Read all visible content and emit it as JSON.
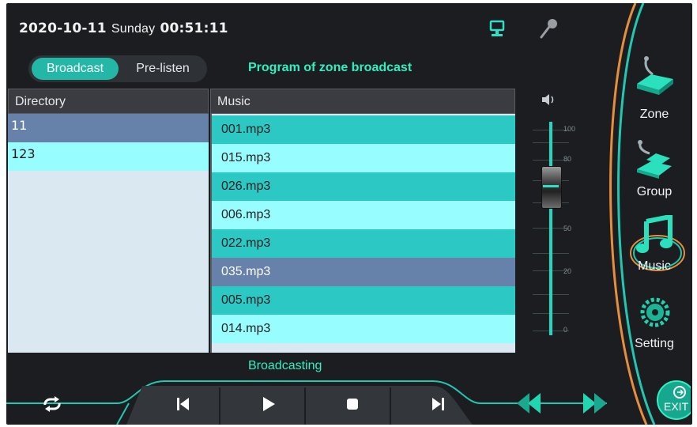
{
  "header": {
    "date": "2020-10-11",
    "weekday": "Sunday",
    "time": "00:51:11",
    "network_icon": "network-icon",
    "mic_icon": "microphone-icon"
  },
  "tabs": [
    {
      "label": "Broadcast",
      "active": true
    },
    {
      "label": "Pre-listen",
      "active": false
    }
  ],
  "program_title": "Program of zone broadcast",
  "directory": {
    "header": "Directory",
    "items": [
      {
        "label": "11",
        "selected": true
      },
      {
        "label": "123",
        "selected": false
      }
    ]
  },
  "music": {
    "header": "Music",
    "items": [
      {
        "label": "001.mp3",
        "selected": false
      },
      {
        "label": "015.mp3",
        "selected": false
      },
      {
        "label": "026.mp3",
        "selected": false
      },
      {
        "label": "006.mp3",
        "selected": false
      },
      {
        "label": "022.mp3",
        "selected": false
      },
      {
        "label": "035.mp3",
        "selected": true
      },
      {
        "label": "005.mp3",
        "selected": false
      },
      {
        "label": "014.mp3",
        "selected": false
      }
    ]
  },
  "volume": {
    "icon": "speaker-icon",
    "scale_labels": [
      "100",
      "80",
      "50",
      "20",
      "0"
    ],
    "level": 75
  },
  "status": "Broadcasting",
  "controls": [
    "repeat-icon",
    "previous-icon",
    "play-icon",
    "stop-icon",
    "next-icon"
  ],
  "nav": [
    {
      "label": "Zone",
      "icon": "zone-icon"
    },
    {
      "label": "Group",
      "icon": "group-icon"
    },
    {
      "label": "Music",
      "icon": "music-note-icon",
      "active": true
    },
    {
      "label": "Setting",
      "icon": "gear-icon"
    }
  ],
  "exit": {
    "label": "EXIT",
    "icon": "exit-icon"
  },
  "colors": {
    "accent": "#22b7a6",
    "title_green": "#2ff0c2",
    "row_teal": "#2bc8c4",
    "row_light": "#97fdfe",
    "row_selected": "#6682aa",
    "orange_arc": "#e58f3c"
  }
}
